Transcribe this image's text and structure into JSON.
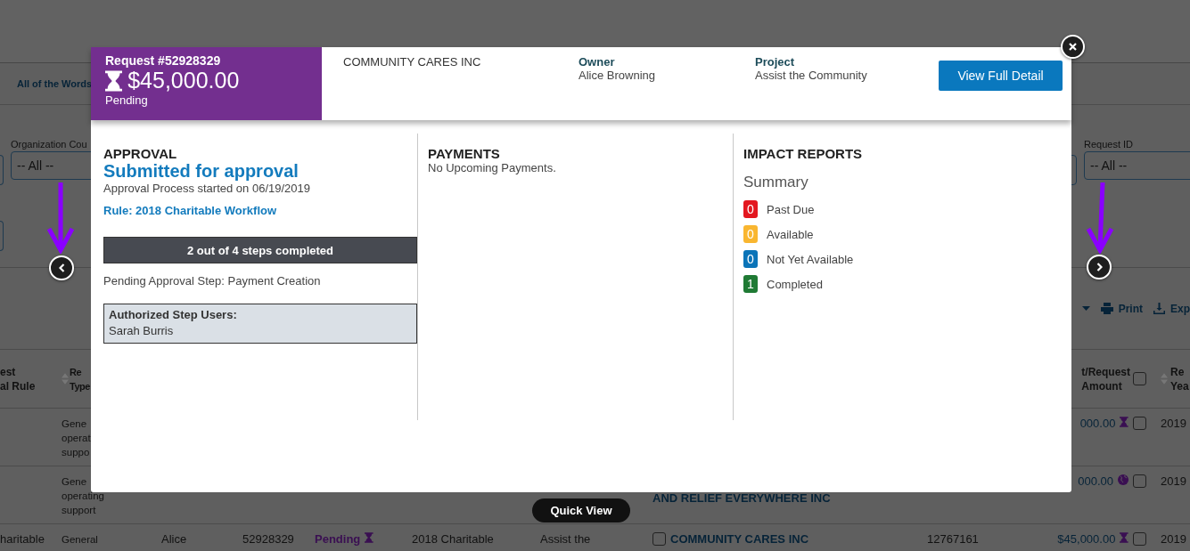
{
  "background": {
    "tab": "All of the Words",
    "filters_left": [
      {
        "label": "Organization Cou",
        "value": "-- All --"
      }
    ],
    "filters_right": [
      {
        "label": "Request ID",
        "value": "-- All --"
      }
    ],
    "toolbar": [
      {
        "kind": "caret"
      },
      {
        "kind": "print",
        "label": "Print"
      },
      {
        "kind": "export",
        "label": "Exp"
      }
    ],
    "table": {
      "columns": {
        "rule": {
          "lines": [
            "est",
            "al Rule"
          ]
        },
        "type": {
          "lines": [
            "Re",
            "Type"
          ],
          "sortable": true
        },
        "amount": {
          "lines": [
            "t/Request",
            "Amount"
          ],
          "checked": false
        },
        "year": {
          "lines": [
            "Re",
            "Yea"
          ],
          "sortable": true
        }
      },
      "rows": [
        {
          "type": {
            "lines": [
              "Gene",
              "operat",
              "suppo"
            ]
          },
          "amount": {
            "text": "000.00",
            "kind": "pending",
            "checked": false
          },
          "year": {
            "text": "2019"
          }
        },
        {
          "type": {
            "lines": [
              "Gene",
              "operating",
              "support"
            ]
          },
          "organization": {
            "text": "AND RELIEF EVERYWHERE INC",
            "continued": true
          },
          "amount": {
            "text": "000.00",
            "kind": "global",
            "checked": false
          },
          "year": {
            "text": "2019"
          }
        },
        {
          "rule": {
            "text": "haritable"
          },
          "type": {
            "lines": [
              "General"
            ]
          },
          "owner": {
            "text": "Alice"
          },
          "request_id": {
            "text": "52928329"
          },
          "status": {
            "text": "Pending",
            "kind": "pending"
          },
          "rule_name": {
            "text": "2018 Charitable"
          },
          "project": {
            "text": "Assist the"
          },
          "organization": {
            "text": "COMMUNITY CARES INC",
            "checked": false
          },
          "code": {
            "text": "12767161"
          },
          "amount": {
            "text": "$45,000.00",
            "kind": "pending",
            "checked": false
          },
          "year": {
            "text": "2019"
          }
        }
      ]
    }
  },
  "modal": {
    "request": {
      "title": "Request #52928329",
      "amount": "$45,000.00",
      "status": "Pending"
    },
    "organization": "COMMUNITY CARES INC",
    "fields": [
      {
        "label": "Owner",
        "value": "Alice Browning"
      },
      {
        "label": "Project",
        "value": "Assist the Community"
      }
    ],
    "action": "View Full Detail",
    "approval": {
      "heading": "APPROVAL",
      "status": "Submitted for approval",
      "started": "Approval Process started on 06/19/2019",
      "rule": "Rule: 2018 Charitable Workflow",
      "progress": "2 out of 4 steps completed",
      "pending_step": "Pending Approval Step: Payment Creation",
      "users_label": "Authorized Step Users:",
      "users": [
        "Sarah Burris"
      ]
    },
    "payments": {
      "heading": "PAYMENTS",
      "message": "No Upcoming Payments."
    },
    "impact_reports": {
      "heading": "IMPACT REPORTS",
      "summary": "Summary",
      "items": [
        {
          "count": "0",
          "label": "Past Due",
          "color": "#e3171f"
        },
        {
          "count": "0",
          "label": "Available",
          "color": "#f9b630"
        },
        {
          "count": "0",
          "label": "Not Yet Available",
          "color": "#0b74b8"
        },
        {
          "count": "1",
          "label": "Completed",
          "color": "#1f7a34"
        }
      ]
    }
  },
  "quick_view": "Quick View"
}
